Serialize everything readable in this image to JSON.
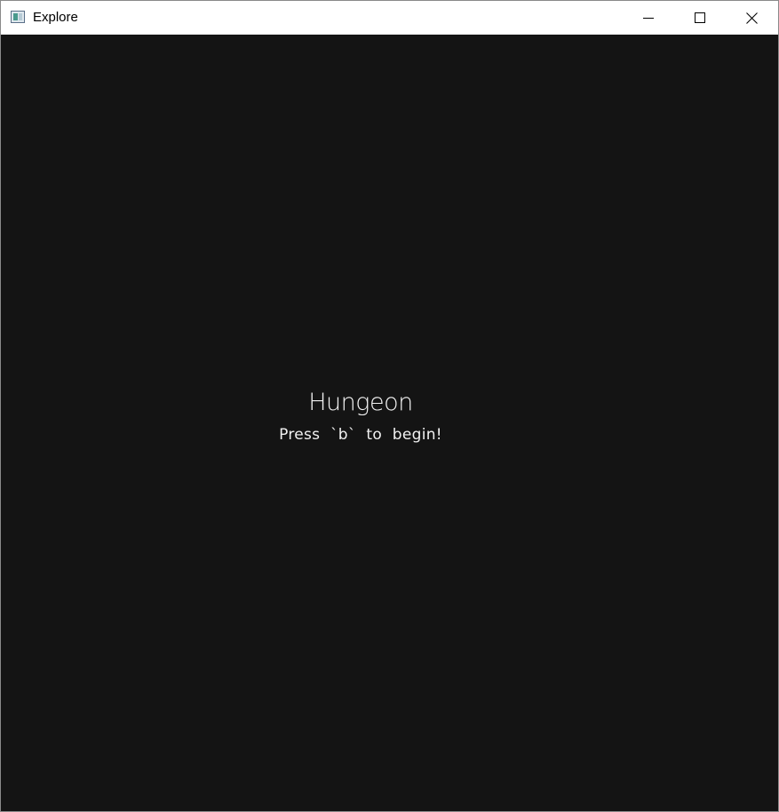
{
  "window": {
    "title": "Explore",
    "icon": "app-window-icon",
    "controls": {
      "minimize_icon": "minimize-icon",
      "maximize_icon": "maximize-icon",
      "close_icon": "close-icon"
    }
  },
  "game": {
    "title": "Hungeon",
    "prompt": "Press `b` to begin!",
    "background_color": "#141414",
    "text_color": "#f2f2f2"
  }
}
